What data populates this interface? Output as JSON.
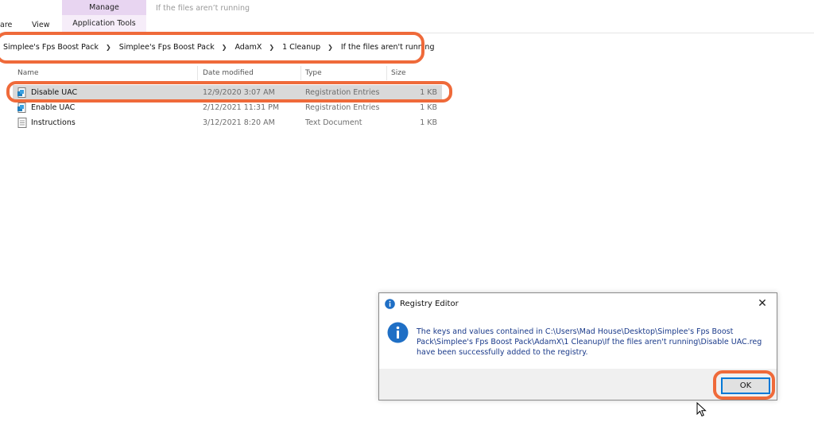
{
  "ribbon": {
    "partial_tab": "are",
    "view_tab": "View",
    "manage_label": "Manage",
    "app_tools_label": "Application Tools",
    "window_title": "If the files aren’t running"
  },
  "breadcrumb": [
    "Simplee's Fps Boost Pack",
    "Simplee's Fps Boost Pack",
    "AdamX",
    "1 Cleanup",
    "If the files aren't running"
  ],
  "columns": {
    "name": "Name",
    "date": "Date modified",
    "type": "Type",
    "size": "Size"
  },
  "files": [
    {
      "name": "Disable UAC",
      "date": "12/9/2020 3:07 AM",
      "type": "Registration Entries",
      "size": "1 KB",
      "icon": "registry-file-icon"
    },
    {
      "name": "Enable UAC",
      "date": "2/12/2021 11:31 PM",
      "type": "Registration Entries",
      "size": "1 KB",
      "icon": "registry-file-icon"
    },
    {
      "name": "Instructions",
      "date": "3/12/2021 8:20 AM",
      "type": "Text Document",
      "size": "1 KB",
      "icon": "text-file-icon"
    }
  ],
  "dialog": {
    "title": "Registry Editor",
    "message_line1": "The keys and values contained in C:\\Users\\Mad House\\Desktop\\Simplee's Fps Boost",
    "message_line2": "Pack\\Simplee's Fps Boost Pack\\AdamX\\1 Cleanup\\If the files aren't running\\Disable UAC.reg",
    "message_line3": "have been successfully added to the registry.",
    "ok_label": "OK",
    "close_symbol": "✕"
  },
  "colors": {
    "highlight": "#ef6a3a",
    "info_blue": "#1f6fc5",
    "selection": "#d9d9d9"
  }
}
